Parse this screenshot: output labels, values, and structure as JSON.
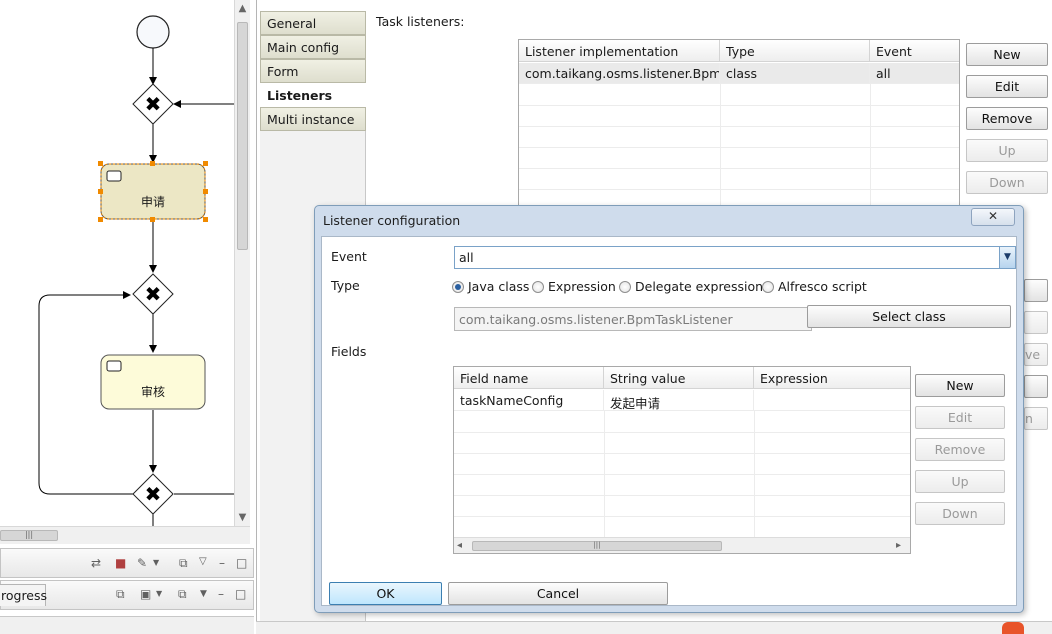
{
  "diagram": {
    "tasks": [
      {
        "label": "申请",
        "selected": true
      },
      {
        "label": "审核",
        "selected": false
      }
    ]
  },
  "bottom_panel": {
    "tab_label": "rogress"
  },
  "property_tabs": [
    "General",
    "Main config",
    "Form",
    "Listeners",
    "Multi instance"
  ],
  "active_tab": "Listeners",
  "task_listeners": {
    "section_label": "Task listeners:",
    "columns": [
      "Listener implementation",
      "Type",
      "Event"
    ],
    "rows": [
      {
        "implementation": "com.taikang.osms.listener.Bpm...",
        "type": "class",
        "event": "all"
      }
    ],
    "buttons": {
      "new": "New",
      "edit": "Edit",
      "remove": "Remove",
      "up": "Up",
      "down": "Down"
    },
    "obscured_fragments": [
      "ve",
      "n"
    ]
  },
  "dialog": {
    "title": "Listener configuration",
    "close_label": "✕",
    "event_label": "Event",
    "event_value": "all",
    "type_label": "Type",
    "type_options": [
      "Java class",
      "Expression",
      "Delegate expression",
      "Alfresco script"
    ],
    "type_selected": "Java class",
    "class_value": "com.taikang.osms.listener.BpmTaskListener",
    "select_class_label": "Select class",
    "fields_label": "Fields",
    "fields_columns": [
      "Field name",
      "String value",
      "Expression"
    ],
    "fields_rows": [
      {
        "name": "taskNameConfig",
        "value": "发起申请",
        "expression": ""
      }
    ],
    "fields_buttons": {
      "new": "New",
      "edit": "Edit",
      "remove": "Remove",
      "up": "Up",
      "down": "Down"
    },
    "ok_label": "OK",
    "cancel_label": "Cancel"
  },
  "colors": {
    "task_selected_fill": "#ece7c5",
    "task_fill": "#fdfbd9",
    "selection_handle": "#f08a00",
    "dialog_frame": "#cfdcec",
    "radio_on": "#2a5fa0"
  }
}
